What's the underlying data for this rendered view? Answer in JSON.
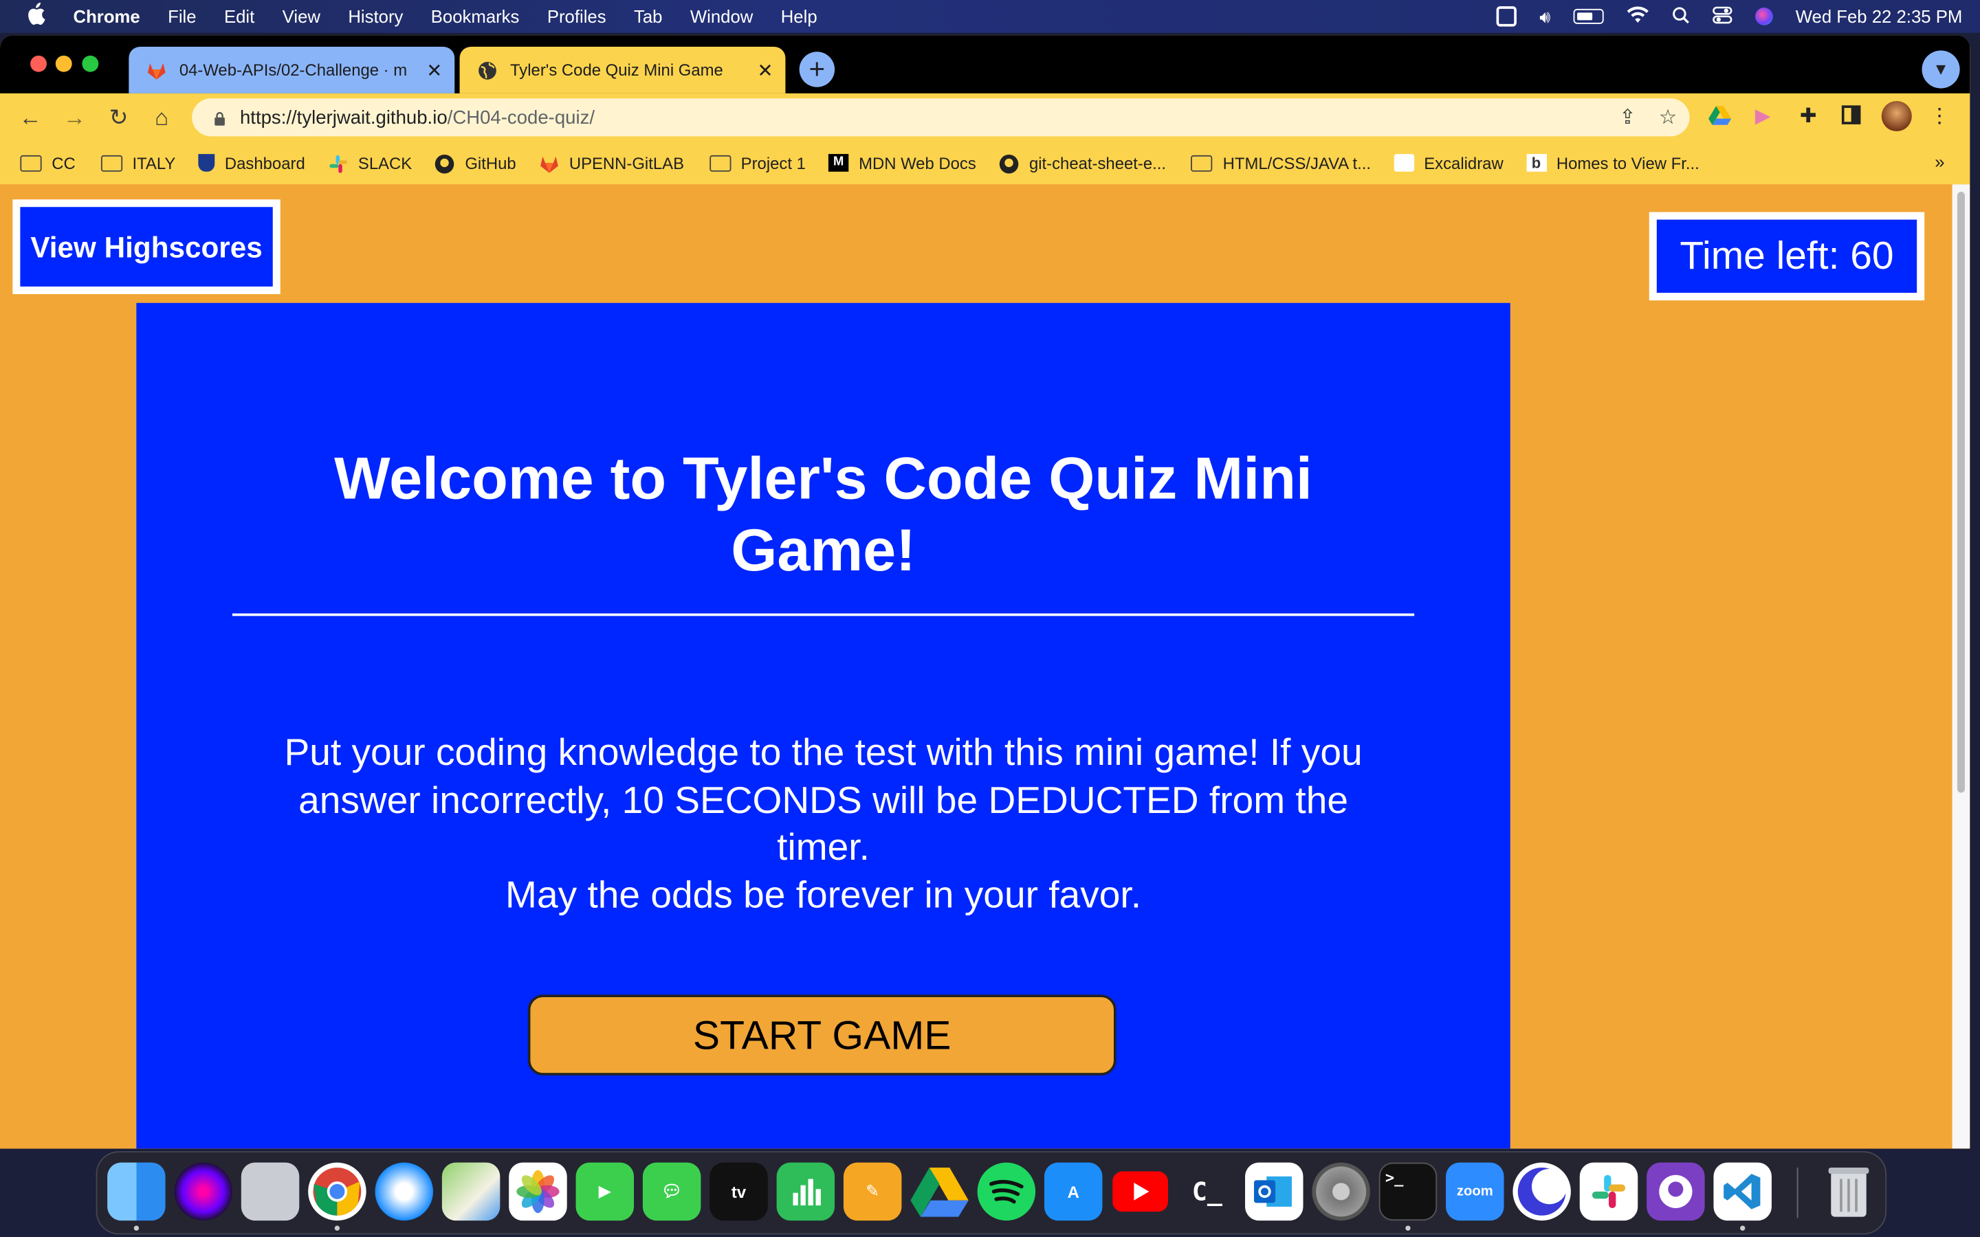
{
  "menubar": {
    "app_name": "Chrome",
    "menus": [
      "File",
      "Edit",
      "View",
      "History",
      "Bookmarks",
      "Profiles",
      "Tab",
      "Window",
      "Help"
    ],
    "clock": "Wed Feb 22  2:35 PM"
  },
  "tabs": [
    {
      "title": "04-Web-APIs/02-Challenge · m",
      "active": false
    },
    {
      "title": "Tyler's Code Quiz Mini Game",
      "active": true
    }
  ],
  "address_bar": {
    "url_scheme_host": "https://tylerjwait.github.io",
    "url_path": "/CH04-code-quiz/"
  },
  "bookmarks": [
    {
      "label": "CC",
      "icon": "folder-icon"
    },
    {
      "label": "ITALY",
      "icon": "folder-icon"
    },
    {
      "label": "Dashboard",
      "icon": "penn-shield-icon"
    },
    {
      "label": "SLACK",
      "icon": "slack-icon"
    },
    {
      "label": "GitHub",
      "icon": "github-icon"
    },
    {
      "label": "UPENN-GitLAB",
      "icon": "gitlab-icon"
    },
    {
      "label": "Project 1",
      "icon": "folder-icon"
    },
    {
      "label": "MDN Web Docs",
      "icon": "mdn-icon"
    },
    {
      "label": "git-cheat-sheet-e...",
      "icon": "github-icon"
    },
    {
      "label": "HTML/CSS/JAVA t...",
      "icon": "folder-icon"
    },
    {
      "label": "Excalidraw",
      "icon": "excalidraw-icon"
    },
    {
      "label": "Homes to View Fr...",
      "icon": "b-icon"
    }
  ],
  "page": {
    "view_highscores": "View Highscores",
    "timer": "Time left: 60",
    "title_line1": "Welcome to Tyler's Code Quiz Mini",
    "title_line2": "Game!",
    "intro_line1": "Put your coding knowledge to the test with this mini game! If you",
    "intro_line2": "answer incorrectly, 10 SECONDS will be DEDUCTED from the",
    "intro_line3": "timer.",
    "intro_line4": "May the odds be forever in your favor.",
    "start_button": "START GAME"
  },
  "dock": [
    "finder",
    "siri",
    "launchpad",
    "chrome",
    "safari",
    "maps",
    "photos",
    "facetime",
    "messages",
    "apple-tv",
    "numbers",
    "pages",
    "google-drive",
    "spotify",
    "app-store",
    "youtube",
    "codecademy",
    "outlook",
    "system-preferences",
    "terminal",
    "zoom",
    "night-owl",
    "slack",
    "github-desktop",
    "vscode",
    "trash"
  ],
  "dock_labels": {
    "apple_tv": "tv",
    "zoom": "zoom",
    "terminal": ">_",
    "codecademy": "C_"
  },
  "colors": {
    "page_bg": "#f2a636",
    "card_bg": "#0026ff",
    "chrome_theme": "#fcd34d",
    "inactive_tab": "#8ab4f8"
  }
}
